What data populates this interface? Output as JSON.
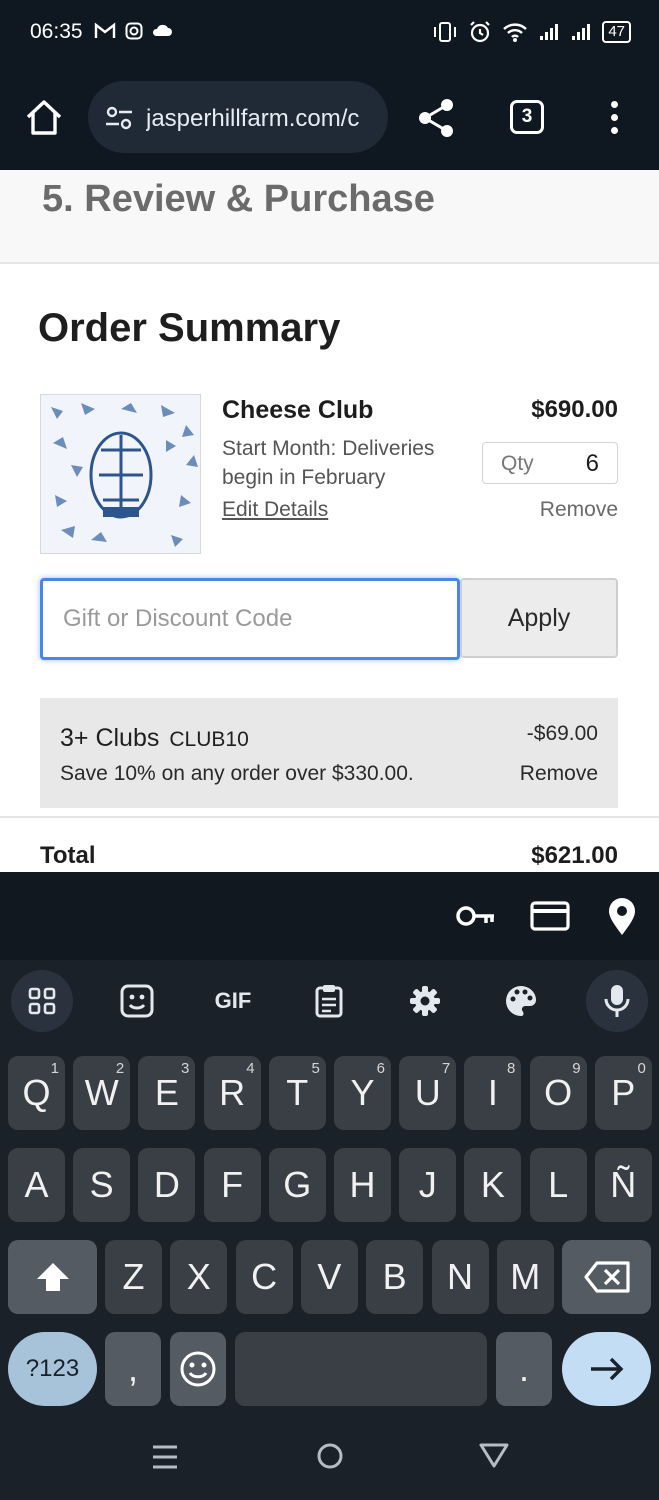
{
  "status_bar": {
    "time": "06:35",
    "battery": "47"
  },
  "browser": {
    "url": "jasperhillfarm.com/c",
    "tab_count": "3"
  },
  "page": {
    "step_title": "5.  Review & Purchase",
    "order_title": "Order Summary",
    "item": {
      "name": "Cheese Club",
      "description": "Start Month: Deliveries begin in February",
      "edit_label": "Edit Details",
      "price": "$690.00",
      "qty_label": "Qty",
      "qty_value": "6",
      "remove_label": "Remove"
    },
    "code_input": {
      "placeholder": "Gift or Discount Code",
      "value": ""
    },
    "apply_label": "Apply",
    "discount": {
      "name": "3+ Clubs",
      "code": "CLUB10",
      "description": "Save 10% on any order over $330.00.",
      "amount": "-$69.00",
      "remove_label": "Remove"
    },
    "total_label": "Total",
    "total_value": "$621.00"
  },
  "keyboard": {
    "toolbar": [
      "apps-icon",
      "sticker-icon",
      "GIF",
      "clipboard-icon",
      "settings-icon",
      "palette-icon",
      "mic-icon"
    ],
    "row1": [
      {
        "k": "Q",
        "n": "1"
      },
      {
        "k": "W",
        "n": "2"
      },
      {
        "k": "E",
        "n": "3"
      },
      {
        "k": "R",
        "n": "4"
      },
      {
        "k": "T",
        "n": "5"
      },
      {
        "k": "Y",
        "n": "6"
      },
      {
        "k": "U",
        "n": "7"
      },
      {
        "k": "I",
        "n": "8"
      },
      {
        "k": "O",
        "n": "9"
      },
      {
        "k": "P",
        "n": "0"
      }
    ],
    "row2": [
      "A",
      "S",
      "D",
      "F",
      "G",
      "H",
      "J",
      "K",
      "L",
      "Ñ"
    ],
    "row3": [
      "Z",
      "X",
      "C",
      "V",
      "B",
      "N",
      "M"
    ],
    "symbols_label": "?123",
    "comma": ",",
    "period": "."
  },
  "colors": {
    "focus_blue": "#4a86e8",
    "enter_key": "#c3ddf4",
    "symbols_key": "#a7c3da"
  }
}
